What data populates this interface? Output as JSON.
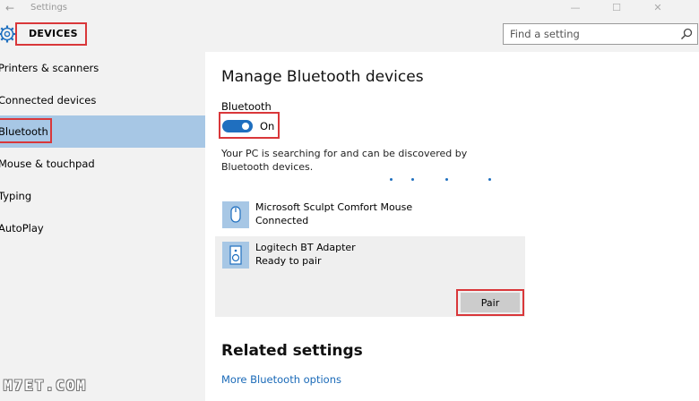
{
  "window": {
    "title": "Settings",
    "back_icon": "arrow-left-icon",
    "controls": [
      "—",
      "☐",
      "✕"
    ]
  },
  "header": {
    "section": "DEVICES",
    "section_icon": "gear-icon",
    "search": {
      "placeholder": "Find a setting",
      "value": "",
      "icon": "search-icon"
    }
  },
  "sidebar": {
    "items": [
      {
        "label": "Printers & scanners",
        "selected": false
      },
      {
        "label": "Connected devices",
        "selected": false
      },
      {
        "label": "Bluetooth",
        "selected": true
      },
      {
        "label": "Mouse & touchpad",
        "selected": false
      },
      {
        "label": "Typing",
        "selected": false
      },
      {
        "label": "AutoPlay",
        "selected": false
      }
    ]
  },
  "main": {
    "title": "Manage Bluetooth devices",
    "bluetooth_label": "Bluetooth",
    "toggle_state": "On",
    "searching_text": "Your PC is searching for and can be discovered by Bluetooth devices.",
    "devices": [
      {
        "name": "Microsoft Sculpt Comfort Mouse",
        "status": "Connected",
        "icon": "mouse-icon"
      },
      {
        "name": "Logitech BT Adapter",
        "status": "Ready to pair",
        "icon": "speaker-icon"
      }
    ],
    "pair_label": "Pair",
    "related_title": "Related settings",
    "more_link": "More Bluetooth options"
  },
  "colors": {
    "accent": "#1f6fbf",
    "selection": "#a7c7e5",
    "highlight_box": "#d9373a",
    "link": "#1a6ab8"
  },
  "watermark": "M7ET.COM"
}
